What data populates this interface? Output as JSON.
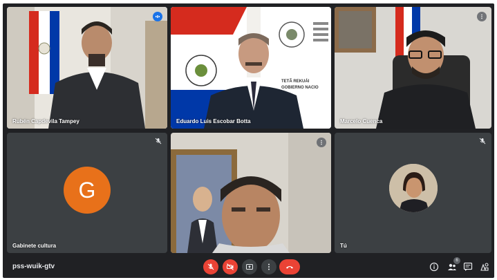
{
  "participants": [
    {
      "name": "Rubén Capdevila Tampey",
      "role": "speaker-highlight"
    },
    {
      "name": "Eduardo Luis Escobar Botta"
    },
    {
      "name": "Marcelo Cuenca"
    },
    {
      "name": "Gabinete cultura",
      "initial": "G"
    },
    {
      "name": ""
    },
    {
      "name": "Tú"
    }
  ],
  "tile2_banner": {
    "line1": "TETÃ REKUÁI",
    "line2": "GOBIERNO NACIO"
  },
  "tile1_wall_text": "cultura",
  "bottom_bar": {
    "meeting_code": "pss-wuik-gtv",
    "participant_count": "6"
  },
  "colors": {
    "accent_blue": "#1a73e8",
    "danger_red": "#ea4335",
    "avatar_orange": "#e8711a",
    "surface": "#202124",
    "tile": "#3c4043"
  }
}
